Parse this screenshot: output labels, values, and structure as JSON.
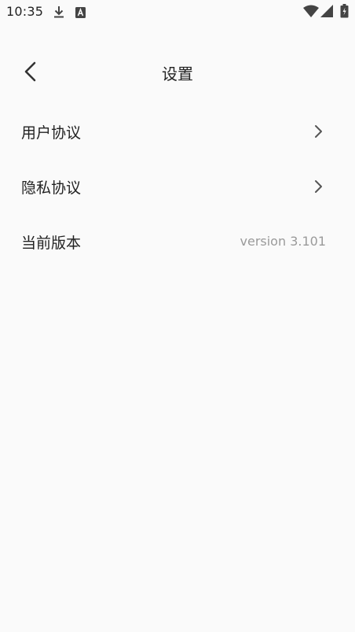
{
  "status_bar": {
    "time": "10:35",
    "icons": [
      "download-icon",
      "a-notification-icon",
      "wifi-icon",
      "signal-icon",
      "battery-icon"
    ]
  },
  "header": {
    "title": "设置",
    "back_icon": "chevron-left-icon"
  },
  "settings": {
    "items": [
      {
        "label": "用户协议",
        "type": "link",
        "icon": "chevron-right-icon"
      },
      {
        "label": "隐私协议",
        "type": "link",
        "icon": "chevron-right-icon"
      },
      {
        "label": "当前版本",
        "type": "value",
        "value": "version 3.101"
      }
    ]
  },
  "colors": {
    "background": "#fafafa",
    "text": "#222222",
    "secondary_text": "#9a9a9a",
    "chevron": "#555555"
  }
}
